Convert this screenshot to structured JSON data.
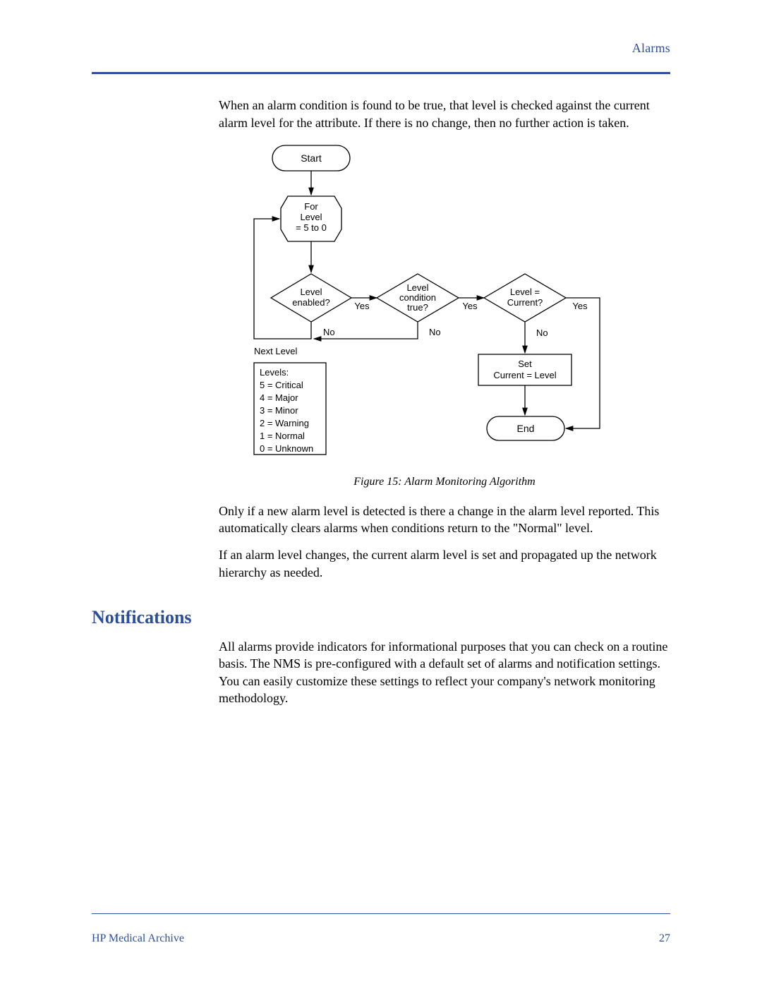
{
  "header": {
    "section": "Alarms"
  },
  "body": {
    "para1": "When an alarm condition is found to be true, that level is checked against the current alarm level for the attribute. If there is no change, then no further action is taken.",
    "para2": "Only if a new alarm level is detected is there a change in the alarm level reported. This automatically clears alarms when conditions return to the \"Normal\" level.",
    "para3": "If an alarm level changes, the current alarm level is set and propagated up the network hierarchy as needed.",
    "para4": "All alarms provide indicators for informational purposes that you can check on a routine basis. The NMS is pre-configured with a default set of alarms and notification settings. You can easily customize these settings to reflect your company's network monitoring methodology."
  },
  "section_heading": "Notifications",
  "figure": {
    "caption": "Figure 15: Alarm Monitoring Algorithm",
    "start": "Start",
    "for_l1": "For",
    "for_l2": "Level",
    "for_l3": "= 5 to 0",
    "d1_l1": "Level",
    "d1_l2": "enabled?",
    "d2_l1": "Level",
    "d2_l2": "condition",
    "d2_l3": "true?",
    "d3_l1": "Level =",
    "d3_l2": "Current?",
    "yes": "Yes",
    "no": "No",
    "next_level": "Next Level",
    "set_l1": "Set",
    "set_l2": "Current = Level",
    "end": "End",
    "levels_l0": "Levels:",
    "levels_l1": "5 = Critical",
    "levels_l2": "4 = Major",
    "levels_l3": "3 = Minor",
    "levels_l4": "2 = Warning",
    "levels_l5": "1 = Normal",
    "levels_l6": "0 = Unknown"
  },
  "footer": {
    "left": "HP Medical Archive",
    "page": "27"
  }
}
